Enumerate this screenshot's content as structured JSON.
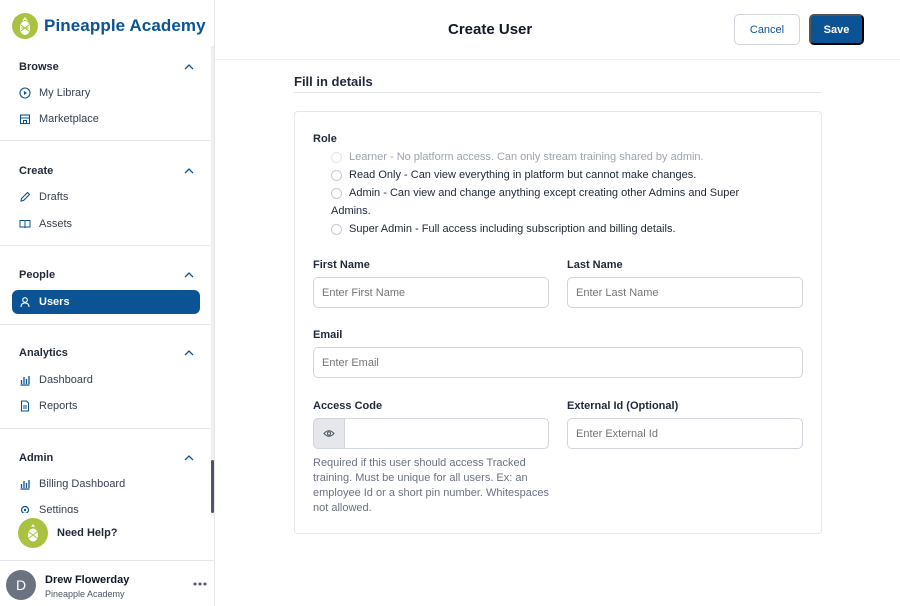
{
  "brand": {
    "name": "Pineapple Academy"
  },
  "sidebar": {
    "sections": [
      {
        "title": "Browse",
        "items": [
          {
            "label": "My Library",
            "icon": "play-circle-icon"
          },
          {
            "label": "Marketplace",
            "icon": "store-icon"
          }
        ]
      },
      {
        "title": "Create",
        "items": [
          {
            "label": "Drafts",
            "icon": "pencil-icon"
          },
          {
            "label": "Assets",
            "icon": "book-icon"
          }
        ]
      },
      {
        "title": "People",
        "items": [
          {
            "label": "Users",
            "icon": "user-icon",
            "active": true
          }
        ]
      },
      {
        "title": "Analytics",
        "items": [
          {
            "label": "Dashboard",
            "icon": "bar-chart-icon"
          },
          {
            "label": "Reports",
            "icon": "document-icon"
          }
        ]
      },
      {
        "title": "Admin",
        "items": [
          {
            "label": "Billing Dashboard",
            "icon": "bar-chart-icon"
          },
          {
            "label": "Settings",
            "icon": "gear-icon"
          }
        ]
      }
    ],
    "help_label": "Need Help?",
    "user": {
      "initial": "D",
      "name": "Drew Flowerday",
      "org": "Pineapple Academy"
    }
  },
  "header": {
    "title": "Create User",
    "cancel_label": "Cancel",
    "save_label": "Save"
  },
  "form": {
    "section_title": "Fill in details",
    "role": {
      "label": "Role",
      "options": [
        {
          "text": "Learner - No platform access. Can only stream training shared by admin.",
          "disabled": true
        },
        {
          "text": "Read Only - Can view everything in platform but cannot make changes.",
          "disabled": false
        },
        {
          "text": "Admin - Can view and change anything except creating other Admins and Super Admins.",
          "disabled": false
        },
        {
          "text": "Super Admin - Full access including subscription and billing details.",
          "disabled": false
        }
      ]
    },
    "first_name": {
      "label": "First Name",
      "placeholder": "Enter First Name",
      "value": ""
    },
    "last_name": {
      "label": "Last Name",
      "placeholder": "Enter Last Name",
      "value": ""
    },
    "email": {
      "label": "Email",
      "placeholder": "Enter Email",
      "value": ""
    },
    "access_code": {
      "label": "Access Code",
      "value": "",
      "hint": "Required if this user should access Tracked training. Must be unique for all users. Ex: an employee Id or a short pin number. Whitespaces not allowed."
    },
    "external_id": {
      "label": "External Id (Optional)",
      "placeholder": "Enter External Id",
      "value": ""
    }
  },
  "colors": {
    "primary": "#0b5394",
    "brand_green": "#a9c23f",
    "border": "#d1d5db"
  }
}
